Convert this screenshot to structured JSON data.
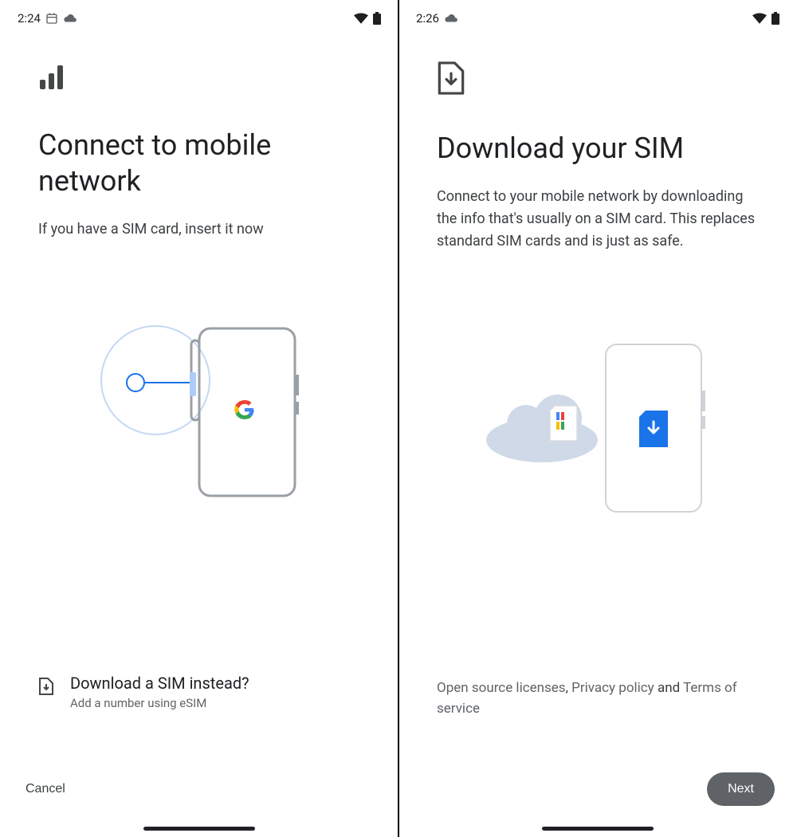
{
  "screen1": {
    "status": {
      "time": "2:24"
    },
    "title": "Connect to mobile network",
    "subtitle": "If you have a SIM card, insert it now",
    "option": {
      "title": "Download a SIM instead?",
      "subtitle": "Add a number using eSIM"
    },
    "footer": {
      "cancel": "Cancel"
    }
  },
  "screen2": {
    "status": {
      "time": "2:26"
    },
    "title": "Download your SIM",
    "subtitle": "Connect to your mobile network by downloading the info that's usually on a SIM card. This replaces standard SIM cards and is just as safe.",
    "legal": {
      "open_source": "Open source licenses",
      "sep1": ", ",
      "privacy": "Privacy policy",
      "sep2": " and ",
      "terms": "Terms of service"
    },
    "footer": {
      "next": "Next"
    }
  }
}
